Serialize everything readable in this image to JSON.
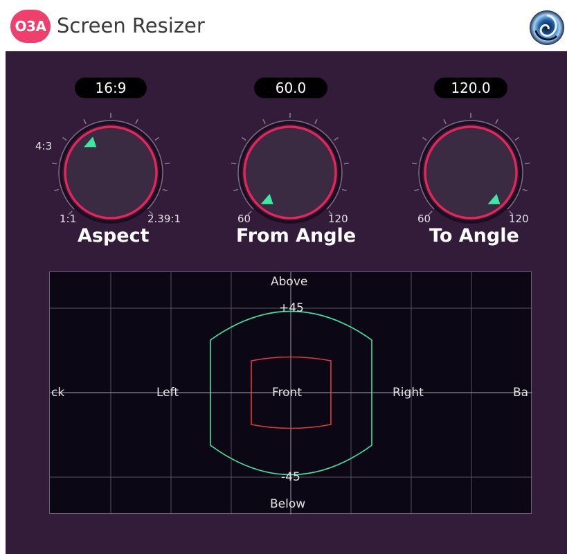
{
  "header": {
    "logo_text": "O3A",
    "title": "Screen Resizer",
    "brand_icon": "swirl-logo-icon"
  },
  "colors": {
    "panel": "#321c3a",
    "knob_ring": "#e3265a",
    "pointer": "#3ee8a0",
    "screen_outline_from": "#3ee8a0",
    "screen_outline_to": "#e33a3a",
    "value_box": "#000000"
  },
  "knobs": [
    {
      "name": "Aspect",
      "value": "16:9",
      "min_label": "1:1",
      "max_label": "2.39:1",
      "mid_label": "4:3"
    },
    {
      "name": "From Angle",
      "value": "60.0",
      "min_label": "60",
      "max_label": "120"
    },
    {
      "name": "To Angle",
      "value": "120.0",
      "min_label": "60",
      "max_label": "120"
    }
  ],
  "graph": {
    "above": "Above",
    "below": "Below",
    "plus45": "+45",
    "minus45": "-45",
    "left": "Left",
    "front": "Front",
    "right": "Right",
    "back_left": "ck",
    "back_right": "Ba"
  }
}
